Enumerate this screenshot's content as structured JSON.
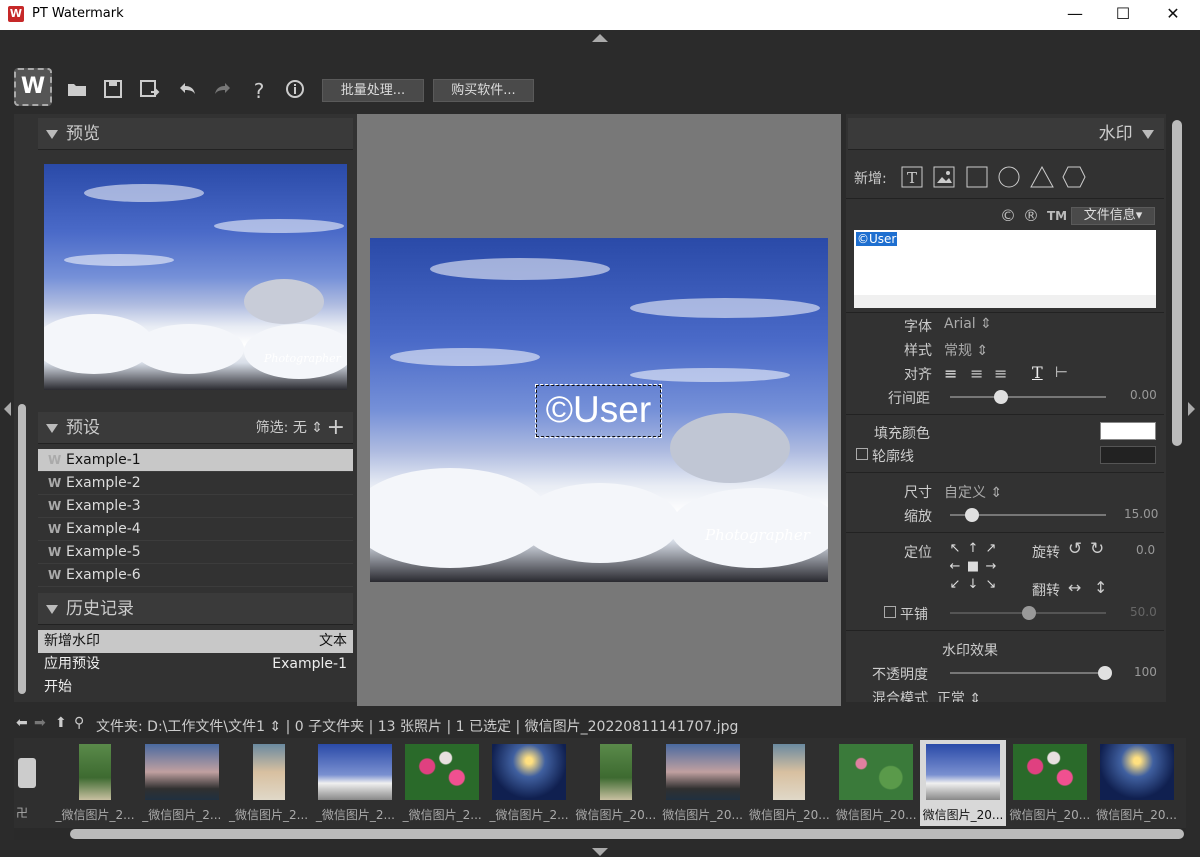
{
  "window": {
    "title": "PT Watermark",
    "minimize": "—",
    "maximize": "☐",
    "close": "✕"
  },
  "toolbar": {
    "batch_label": "批量处理...",
    "buy_label": "购买软件...",
    "app_icon_letter": "W"
  },
  "left": {
    "preview_title": "预览",
    "preview_watermark": "Photographer",
    "presets_title": "预设",
    "filter_label": "筛选:",
    "filter_value": "无",
    "presets": [
      "Example-1",
      "Example-2",
      "Example-3",
      "Example-4",
      "Example-5",
      "Example-6"
    ],
    "history_title": "历史记录",
    "history": [
      {
        "action": "新增水印",
        "detail": "文本"
      },
      {
        "action": "应用预设",
        "detail": "Example-1"
      },
      {
        "action": "开始",
        "detail": ""
      }
    ]
  },
  "canvas": {
    "watermark_text": "©User",
    "photo_signature": "Photographer"
  },
  "right": {
    "title": "水印",
    "add_label": "新增:",
    "symbols": {
      "copyright": "©",
      "registered": "®",
      "tm": "TM"
    },
    "file_info_label": "文件信息",
    "text_value": "©User",
    "font_label": "字体",
    "font_value": "Arial",
    "style_label": "样式",
    "style_value": "常规",
    "align_label": "对齐",
    "line_spacing_label": "行间距",
    "line_spacing_value": "0.00",
    "fill_color_label": "填充颜色",
    "outline_label": "轮廓线",
    "size_label": "尺寸",
    "size_value": "自定义",
    "scale_label": "缩放",
    "scale_value": "15.00",
    "position_label": "定位",
    "rotate_label": "旋转",
    "rotate_value": "0.0",
    "flip_label": "翻转",
    "tile_label": "平铺",
    "tile_value": "50.0",
    "effects_title": "水印效果",
    "opacity_label": "不透明度",
    "opacity_value": "100",
    "blend_label": "混合模式",
    "blend_value": "正常",
    "colors": {
      "fill": "#ffffff",
      "outline": "#222222"
    }
  },
  "pathbar": {
    "text": "文件夹:  D:\\工作文件\\文件1 ⇕ | 0 子文件夹 | 13 张照片 | 1 已选定 | 微信图片_20220811141707.jpg"
  },
  "filmstrip": {
    "items": [
      {
        "caption": "_微信图片_2...",
        "kind": "path"
      },
      {
        "caption": "_微信图片_2...",
        "kind": "dusk"
      },
      {
        "caption": "_微信图片_2...",
        "kind": "cat"
      },
      {
        "caption": "_微信图片_2...",
        "kind": "skyt"
      },
      {
        "caption": "_微信图片_2...",
        "kind": "flow"
      },
      {
        "caption": "_微信图片_2...",
        "kind": "night"
      },
      {
        "caption": "微信图片_20...",
        "kind": "path"
      },
      {
        "caption": "微信图片_20...",
        "kind": "dusk"
      },
      {
        "caption": "微信图片_20...",
        "kind": "cat"
      },
      {
        "caption": "微信图片_20...",
        "kind": "lotus"
      },
      {
        "caption": "微信图片_20...",
        "kind": "skyt",
        "selected": true
      },
      {
        "caption": "微信图片_20...",
        "kind": "flow"
      },
      {
        "caption": "微信图片_20...",
        "kind": "night"
      }
    ]
  }
}
